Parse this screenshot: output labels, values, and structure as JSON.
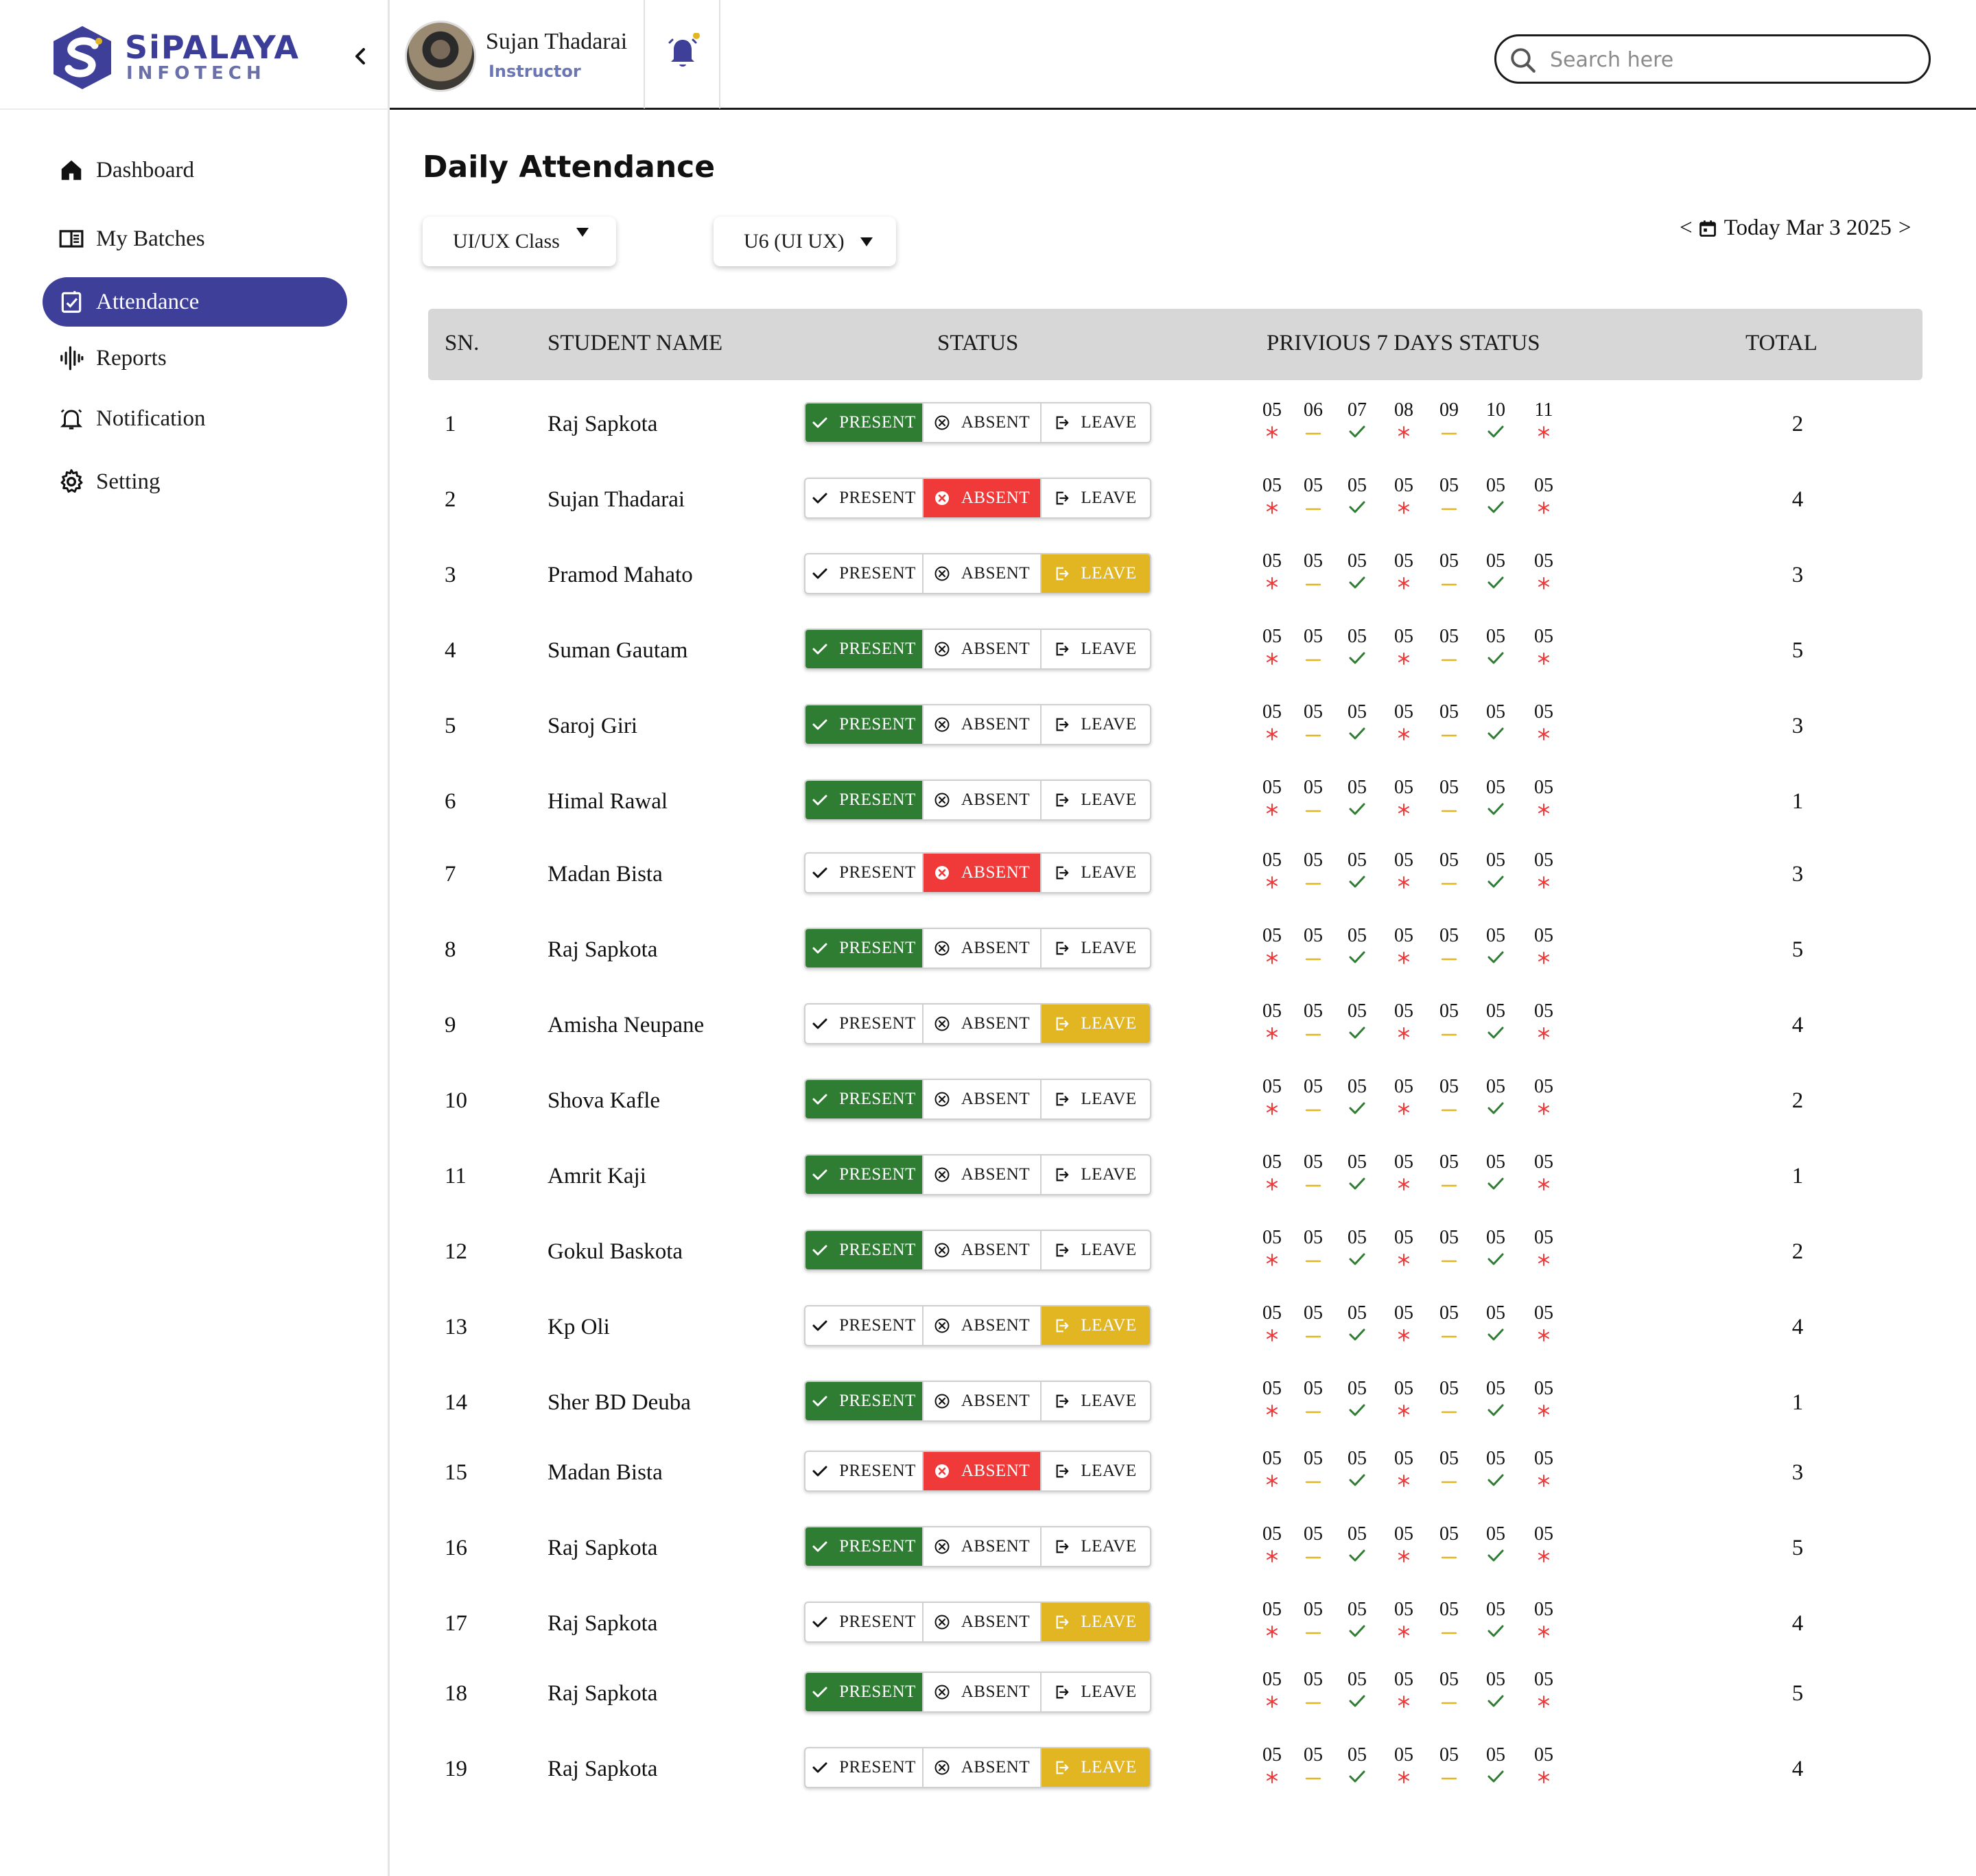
{
  "brand": {
    "name": "SiPALAYA",
    "sub": "INFOTECH"
  },
  "user": {
    "name": "Sujan Thadarai",
    "role": "Instructor"
  },
  "search": {
    "placeholder": "Search here"
  },
  "nav": [
    {
      "label": "Dashboard",
      "icon": "home-icon",
      "active": false
    },
    {
      "label": "My Batches",
      "icon": "book-open-icon",
      "active": false
    },
    {
      "label": "Attendance",
      "icon": "attendance-icon",
      "active": true
    },
    {
      "label": "Reports",
      "icon": "waveform-icon",
      "active": false
    },
    {
      "label": "Notification",
      "icon": "bell-outline-icon",
      "active": false
    },
    {
      "label": "Setting",
      "icon": "gear-icon",
      "active": false
    }
  ],
  "page": {
    "title": "Daily Attendance"
  },
  "filters": {
    "class": "UI/UX Class",
    "batch": "U6 (UI UX)"
  },
  "date": {
    "prev": "<",
    "label": "Today Mar 3 2025",
    "next": ">"
  },
  "table": {
    "headers": {
      "sn": "SN.",
      "name": "STUDENT NAME",
      "status": "STATUS",
      "prev": "PRIVIOUS 7 DAYS STATUS",
      "total": "TOTAL"
    },
    "status_labels": {
      "present": "PRESENT",
      "absent": "ABSENT",
      "leave": "LEAVE"
    },
    "prev_marks": [
      "absent",
      "leave",
      "present",
      "absent",
      "leave",
      "present",
      "absent"
    ],
    "rows": [
      {
        "sn": "1",
        "name": "Raj Sapkota",
        "status": "present",
        "days": [
          "05",
          "06",
          "07",
          "08",
          "09",
          "10",
          "11"
        ],
        "total": "2"
      },
      {
        "sn": "2",
        "name": "Sujan Thadarai",
        "status": "absent",
        "days": [
          "05",
          "05",
          "05",
          "05",
          "05",
          "05",
          "05"
        ],
        "total": "4"
      },
      {
        "sn": "3",
        "name": "Pramod Mahato",
        "status": "leave",
        "days": [
          "05",
          "05",
          "05",
          "05",
          "05",
          "05",
          "05"
        ],
        "total": "3"
      },
      {
        "sn": "4",
        "name": "Suman Gautam",
        "status": "present",
        "days": [
          "05",
          "05",
          "05",
          "05",
          "05",
          "05",
          "05"
        ],
        "total": "5"
      },
      {
        "sn": "5",
        "name": "Saroj Giri",
        "status": "present",
        "days": [
          "05",
          "05",
          "05",
          "05",
          "05",
          "05",
          "05"
        ],
        "total": "3"
      },
      {
        "sn": "6",
        "name": "Himal Rawal",
        "status": "present",
        "days": [
          "05",
          "05",
          "05",
          "05",
          "05",
          "05",
          "05"
        ],
        "total": "1"
      },
      {
        "sn": "7",
        "name": "Madan Bista",
        "status": "absent",
        "days": [
          "05",
          "05",
          "05",
          "05",
          "05",
          "05",
          "05"
        ],
        "total": "3"
      },
      {
        "sn": "8",
        "name": "Raj Sapkota",
        "status": "present",
        "days": [
          "05",
          "05",
          "05",
          "05",
          "05",
          "05",
          "05"
        ],
        "total": "5"
      },
      {
        "sn": "9",
        "name": "Amisha Neupane",
        "status": "leave",
        "days": [
          "05",
          "05",
          "05",
          "05",
          "05",
          "05",
          "05"
        ],
        "total": "4"
      },
      {
        "sn": "10",
        "name": "Shova Kafle",
        "status": "present",
        "days": [
          "05",
          "05",
          "05",
          "05",
          "05",
          "05",
          "05"
        ],
        "total": "2"
      },
      {
        "sn": "11",
        "name": "Amrit Kaji",
        "status": "present",
        "days": [
          "05",
          "05",
          "05",
          "05",
          "05",
          "05",
          "05"
        ],
        "total": "1"
      },
      {
        "sn": "12",
        "name": "Gokul Baskota",
        "status": "present",
        "days": [
          "05",
          "05",
          "05",
          "05",
          "05",
          "05",
          "05"
        ],
        "total": "2"
      },
      {
        "sn": "13",
        "name": "Kp Oli",
        "status": "leave",
        "days": [
          "05",
          "05",
          "05",
          "05",
          "05",
          "05",
          "05"
        ],
        "total": "4"
      },
      {
        "sn": "14",
        "name": "Sher BD Deuba",
        "status": "present",
        "days": [
          "05",
          "05",
          "05",
          "05",
          "05",
          "05",
          "05"
        ],
        "total": "1"
      },
      {
        "sn": "15",
        "name": "Madan Bista",
        "status": "absent",
        "days": [
          "05",
          "05",
          "05",
          "05",
          "05",
          "05",
          "05"
        ],
        "total": "3"
      },
      {
        "sn": "16",
        "name": "Raj Sapkota",
        "status": "present",
        "days": [
          "05",
          "05",
          "05",
          "05",
          "05",
          "05",
          "05"
        ],
        "total": "5"
      },
      {
        "sn": "17",
        "name": "Raj Sapkota",
        "status": "leave",
        "days": [
          "05",
          "05",
          "05",
          "05",
          "05",
          "05",
          "05"
        ],
        "total": "4"
      },
      {
        "sn": "18",
        "name": "Raj Sapkota",
        "status": "present",
        "days": [
          "05",
          "05",
          "05",
          "05",
          "05",
          "05",
          "05"
        ],
        "total": "5"
      },
      {
        "sn": "19",
        "name": "Raj Sapkota",
        "status": "leave",
        "days": [
          "05",
          "05",
          "05",
          "05",
          "05",
          "05",
          "05"
        ],
        "total": "4"
      }
    ]
  },
  "colors": {
    "primary": "#3d3f98",
    "present": "#2e7d32",
    "absent": "#f03a3a",
    "leave": "#e2b623",
    "notification_dot": "#e2b623",
    "absent_mark": "#f03a3a",
    "leave_mark": "#e2b623",
    "present_mark": "#2e7d32"
  }
}
